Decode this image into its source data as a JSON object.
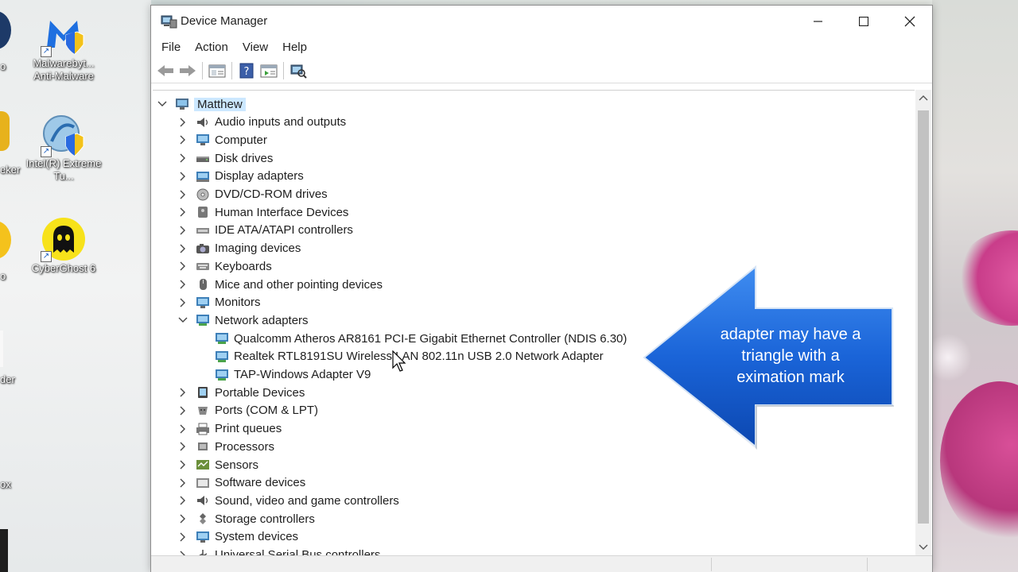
{
  "desktop": {
    "icons": [
      {
        "name": "malwarebytes",
        "label": "Malwarebyt... Anti-Malware"
      },
      {
        "name": "intel-xtu",
        "label": "Intel(R) Extreme Tu..."
      },
      {
        "name": "cyberghost",
        "label": "CyberGhost 6"
      }
    ],
    "partial_labels": [
      "o",
      "eker",
      "o",
      "der",
      "ox"
    ]
  },
  "window": {
    "title": "Device Manager",
    "menu": [
      "File",
      "Action",
      "View",
      "Help"
    ],
    "toolbar": [
      "back",
      "forward",
      "properties",
      "help",
      "update-driver",
      "scan-hardware"
    ]
  },
  "tree": {
    "root": "Matthew",
    "items": [
      {
        "label": "Audio inputs and outputs",
        "icon": "speaker-icon",
        "expanded": false,
        "children": []
      },
      {
        "label": "Computer",
        "icon": "monitor-icon",
        "expanded": false,
        "children": []
      },
      {
        "label": "Disk drives",
        "icon": "disk-icon",
        "expanded": false,
        "children": []
      },
      {
        "label": "Display adapters",
        "icon": "display-adapter-icon",
        "expanded": false,
        "children": []
      },
      {
        "label": "DVD/CD-ROM drives",
        "icon": "dvd-icon",
        "expanded": false,
        "children": []
      },
      {
        "label": "Human Interface Devices",
        "icon": "hid-icon",
        "expanded": false,
        "children": []
      },
      {
        "label": "IDE ATA/ATAPI controllers",
        "icon": "ide-icon",
        "expanded": false,
        "children": []
      },
      {
        "label": "Imaging devices",
        "icon": "camera-icon",
        "expanded": false,
        "children": []
      },
      {
        "label": "Keyboards",
        "icon": "keyboard-icon",
        "expanded": false,
        "children": []
      },
      {
        "label": "Mice and other pointing devices",
        "icon": "mouse-icon",
        "expanded": false,
        "children": []
      },
      {
        "label": "Monitors",
        "icon": "monitor-icon",
        "expanded": false,
        "children": []
      },
      {
        "label": "Network adapters",
        "icon": "network-icon",
        "expanded": true,
        "children": [
          "Qualcomm Atheros AR8161 PCI-E Gigabit Ethernet Controller (NDIS 6.30)",
          "Realtek RTL8191SU Wireless LAN 802.11n USB 2.0 Network Adapter",
          "TAP-Windows Adapter V9"
        ]
      },
      {
        "label": "Portable Devices",
        "icon": "portable-device-icon",
        "expanded": false,
        "children": []
      },
      {
        "label": "Ports (COM & LPT)",
        "icon": "port-icon",
        "expanded": false,
        "children": []
      },
      {
        "label": "Print queues",
        "icon": "printer-icon",
        "expanded": false,
        "children": []
      },
      {
        "label": "Processors",
        "icon": "cpu-icon",
        "expanded": false,
        "children": []
      },
      {
        "label": "Sensors",
        "icon": "sensor-icon",
        "expanded": false,
        "children": []
      },
      {
        "label": "Software devices",
        "icon": "software-device-icon",
        "expanded": false,
        "children": []
      },
      {
        "label": "Sound, video and game controllers",
        "icon": "speaker-icon",
        "expanded": false,
        "children": []
      },
      {
        "label": "Storage controllers",
        "icon": "storage-icon",
        "expanded": false,
        "children": []
      },
      {
        "label": "System devices",
        "icon": "monitor-icon",
        "expanded": false,
        "children": []
      },
      {
        "label": "Universal Serial Bus controllers",
        "icon": "usb-icon",
        "expanded": false,
        "children": []
      }
    ]
  },
  "callout": {
    "text_lines": [
      "adapter may have a",
      "triangle with a",
      "eximation mark"
    ],
    "color": "#1a64d8"
  },
  "colors": {
    "selection": "#cce8ff",
    "accent": "#0078d7"
  }
}
